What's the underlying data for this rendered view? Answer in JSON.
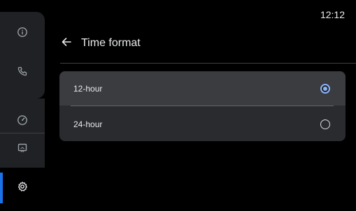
{
  "status_bar": {
    "time": "12:12"
  },
  "rail": {
    "items": [
      {
        "icon": "info-icon",
        "active": false
      },
      {
        "icon": "phone-icon",
        "active": false
      },
      {
        "icon": "speedometer-icon",
        "active": false
      },
      {
        "icon": "display-icon",
        "active": false
      },
      {
        "icon": "gear-icon",
        "active": true
      }
    ],
    "accent": "#1a73e8"
  },
  "header": {
    "title": "Time format",
    "back_icon": "arrow-left-icon"
  },
  "options": [
    {
      "label": "12-hour",
      "selected": true
    },
    {
      "label": "24-hour",
      "selected": false
    }
  ],
  "colors": {
    "background": "#000000",
    "radio_selected": "#8ab4f8",
    "panel": "#2a2b2f"
  }
}
